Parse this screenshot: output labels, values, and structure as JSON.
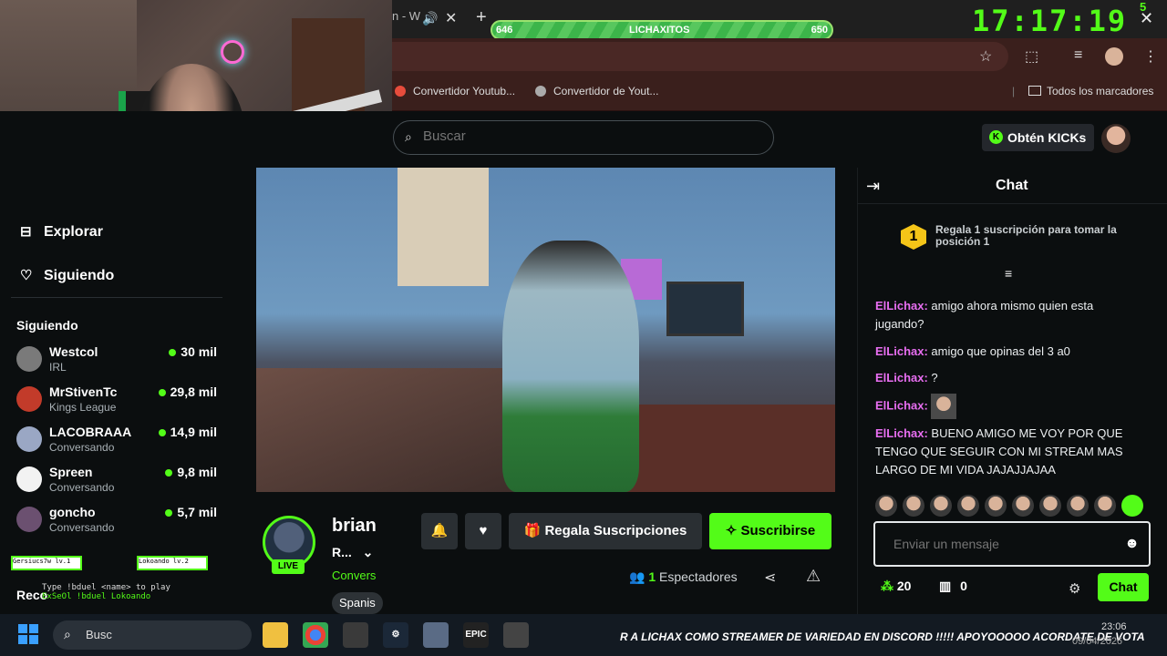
{
  "browser": {
    "tab_title": "n - W",
    "bookmarks": [
      "Convertidor Youtub...",
      "Convertidor de Yout...",
      "Todos los marcadores"
    ]
  },
  "overlay": {
    "goal_left": "646",
    "goal_name": "LICHAXITOS",
    "goal_right": "650",
    "clock": "17:17:19",
    "corner_text": "5",
    "mini_box_1": "Gersiucs7w  lv.1",
    "mini_box_2": "Lokoando  lv.2",
    "type_line": "Type !bduel <name> to play",
    "type_line2": "ExSeOl !bduel Lokoando"
  },
  "kick": {
    "search_placeholder": "Buscar",
    "kicks_button": "Obtén KICKs",
    "nav": {
      "explore": "Explorar",
      "following": "Siguiendo"
    },
    "following_title": "Siguiendo",
    "channels": [
      {
        "name": "Westcol",
        "category": "IRL",
        "viewers": "30 mil",
        "color": "#7a7a7a"
      },
      {
        "name": "MrStivenTc",
        "category": "Kings League",
        "viewers": "29,8 mil",
        "color": "#c23b2a"
      },
      {
        "name": "LACOBRAAA",
        "category": "Conversando",
        "viewers": "14,9 mil",
        "color": "#9aa7c4"
      },
      {
        "name": "Spreen",
        "category": "Conversando",
        "viewers": "9,8 mil",
        "color": "#f2f2f2"
      },
      {
        "name": "goncho",
        "category": "Conversando",
        "viewers": "5,7 mil",
        "color": "#6b5070"
      }
    ],
    "recommended_title": "Reco",
    "channel": {
      "name": "brian",
      "sub": "R...",
      "category": "Convers",
      "tag": "Spanis",
      "live": "LIVE",
      "gift_button": "Regala Suscripciones",
      "subscribe_button": "Suscribirse",
      "viewers_count": "1",
      "viewers_label": "Espectadores"
    }
  },
  "chat": {
    "title": "Chat",
    "pinned": "Regala 1 suscripción para tomar la posición 1",
    "pinned_rank": "1",
    "messages": [
      {
        "user": "ElLichax:",
        "text": " amigo ahora mismo quien esta jugando?"
      },
      {
        "user": "ElLichax:",
        "text": " amigo que opinas del 3 a0"
      },
      {
        "user": "ElLichax:",
        "text": " ?"
      },
      {
        "user": "ElLichax:",
        "text": ""
      },
      {
        "user": "ElLichax:",
        "text": " BUENO AMIGO ME VOY POR QUE TENGO QUE SEGUIR CON MI STREAM MAS LARGO DE MI VIDA JAJAJJAJAA"
      }
    ],
    "input_placeholder": "Enviar un mensaje",
    "points": "20",
    "drops": "0",
    "send_button": "Chat"
  },
  "taskbar": {
    "search_label": "Busc",
    "ticker": "R A LICHAX COMO STREAMER DE VARIEDAD EN DISCORD !!!!! APOYOOOOO   ACORDATE DE VOTA",
    "time": "23:06",
    "date": "09/04/2026"
  }
}
